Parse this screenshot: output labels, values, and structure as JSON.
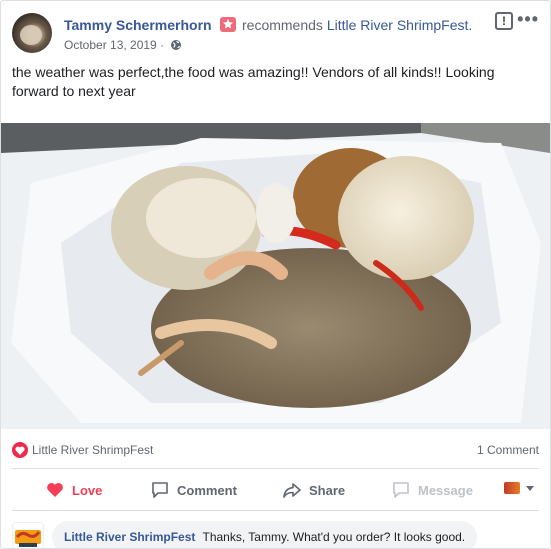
{
  "post": {
    "author": "Tammy Schermerhorn",
    "action": "recommends",
    "page": "Little River ShrimpFest.",
    "date": "October 13, 2019 ·",
    "text": "the weather was perfect,the food was amazing!! Vendors of all kinds!! Looking forward to next year"
  },
  "stats": {
    "reaction_name": "Little River ShrimpFest",
    "comments": "1 Comment"
  },
  "actions": {
    "love": "Love",
    "comment": "Comment",
    "share": "Share",
    "message": "Message"
  },
  "comment": {
    "author": "Little River ShrimpFest",
    "text": "Thanks, Tammy. What'd you order? It looks good."
  },
  "colors": {
    "link": "#385898",
    "love": "#f33e58",
    "muted": "#606770"
  },
  "icons": [
    "recommend-star-icon",
    "globe-icon",
    "flag-icon",
    "more-icon",
    "love-reaction-icon",
    "heart-icon",
    "comment-icon",
    "share-icon",
    "message-icon",
    "page-logo-icon",
    "caret-down-icon"
  ]
}
